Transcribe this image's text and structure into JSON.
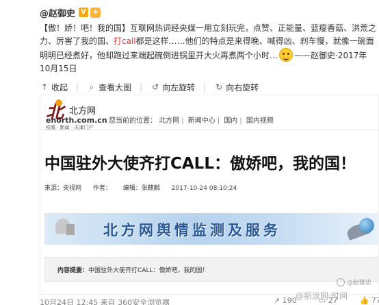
{
  "author": {
    "name": "@赵御史",
    "verified_badge": "V",
    "medal_icon": "medal-icon"
  },
  "post": {
    "part1": "【傲！娇！吧！我的国】互联网热词经央媒一用立刻玩完，点赞、正能量、蓝瘦香菇、洪荒之力、厉害了我的国、",
    "highlight": "打call",
    "part2": "都是这样……他们的特点是来得晚、喊得凶、刹车慢，就像一碗面明明已经煮好，他却跑过来端起碗倒进锅里开大火再煮两个小时…",
    "part3": "——赵御史·2017年10月15日",
    "emoji": "smile-emoji"
  },
  "toolbar": {
    "collapse": "收起",
    "view_large": "查看大图",
    "rotate_left": "向左旋转",
    "rotate_right": "向右旋转"
  },
  "screenshot": {
    "logo_title": "北方网",
    "logo_url": "enorth.com.cn",
    "logo_slogan": "权威 · 新闻 · 天津门户",
    "breadcrumb_label": "您当前的位置：",
    "breadcrumbs": [
      "北方网",
      "新闻中心",
      "国内",
      "国内视频"
    ],
    "headline": "中国驻外大使齐打CALL：傲娇吧，我的国！",
    "source_label": "来源：央视网",
    "author_label": "作者：",
    "editor_label": "编辑：张麒麟",
    "time": "2017-10-24 08:10:24",
    "banner_text": "北方网舆情监测及服务",
    "summary_label": "内容提要：",
    "summary_text": "中国驻外大使齐打CALL：傲娇吧，我的国！",
    "watermark": "@赵御史"
  },
  "footer": {
    "meta": "10月24日 12:45 来自 360安全浏览器",
    "shares": "190",
    "comments": "27",
    "likes": "77",
    "watermark": "@新浪网·时间"
  }
}
